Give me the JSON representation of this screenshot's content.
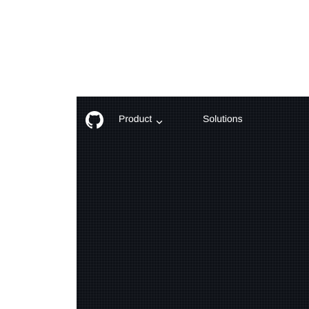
{
  "navbar": {
    "logo_icon": "github-mark-icon",
    "items": [
      {
        "label": "Product",
        "has_dropdown": true
      },
      {
        "label": "Solutions",
        "has_dropdown": true
      }
    ]
  },
  "colors": {
    "background": "#0e1117",
    "text": "#ffffff"
  }
}
